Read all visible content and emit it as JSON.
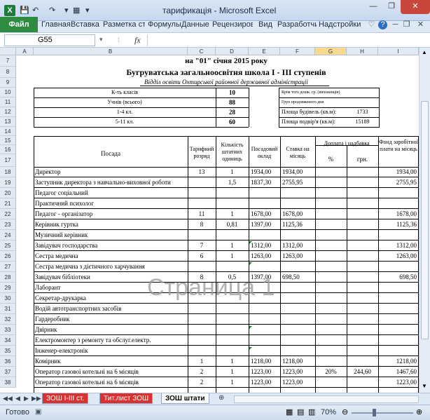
{
  "window": {
    "title": "тарификація  -  Microsoft Excel"
  },
  "ribbon": {
    "file_tab": "Файл",
    "tabs": [
      "Главная",
      "Вставка",
      "Разметка стр",
      "Формулы",
      "Данные",
      "Рецензиров",
      "Вид",
      "Разработчи",
      "Надстройки"
    ]
  },
  "formula_bar": {
    "name_box": "G55",
    "fx": "fx",
    "content": ""
  },
  "columns": [
    "A",
    "B",
    "C",
    "D",
    "E",
    "F",
    "G",
    "H",
    "I"
  ],
  "rows": [
    "7",
    "8",
    "9",
    "10",
    "11",
    "12",
    "13",
    "14",
    "15",
    "16",
    "17",
    "18",
    "19",
    "20",
    "21",
    "22",
    "23",
    "24",
    "25",
    "26",
    "27",
    "28",
    "29",
    "30",
    "31",
    "32",
    "33",
    "34",
    "35",
    "36",
    "37",
    "38"
  ],
  "sheet": {
    "date": "на  \"01\" січня 2015 року",
    "school": "Бугруватська загальноосвітня  школа  І - ІІІ  ступенів",
    "dept": "Відділ  освіти  Охтирської  районної державної  адміністрації",
    "info_left": [
      {
        "label": "К-ть класів",
        "value": "10"
      },
      {
        "label": "Учнів (всього)",
        "value": "88"
      },
      {
        "label": "1-4 кл.",
        "value": "28"
      },
      {
        "label": "5-11 кл.",
        "value": "60"
      }
    ],
    "info_right": [
      {
        "label": "Крім того дошк. гр. (вихованців)",
        "value": ""
      },
      {
        "label": "Груп продовженого  дня",
        "value": ""
      },
      {
        "label": "Площа  будівель (кв.м):",
        "value": "1733"
      },
      {
        "label": "Площа подвір'я (кв.м):",
        "value": "15189"
      }
    ],
    "headers": {
      "position": "Посада",
      "tarif": "Тарифний розряд",
      "count": "Кількість штатних одиниць",
      "salary": "Посадовий оклад",
      "rate": "Ставка на місяць",
      "allowance": "Доплата і надбавка",
      "pct": "%",
      "uah": "грн.",
      "fund": "Фонд заробітної плати на місяць"
    },
    "staff": [
      {
        "name": "Директор",
        "tarif": "13",
        "count": "1",
        "salary": "1934,00",
        "rate": "1934,00",
        "pct": "",
        "uah": "",
        "fund": "1934,00"
      },
      {
        "name": "Заступник директора з навчально-виховної роботи",
        "tarif": "",
        "count": "1,5",
        "salary": "1837,30",
        "rate": "2755,95",
        "pct": "",
        "uah": "",
        "fund": "2755,95"
      },
      {
        "name": "Педагог соціальний",
        "tarif": "",
        "count": "",
        "salary": "",
        "rate": "",
        "pct": "",
        "uah": "",
        "fund": ""
      },
      {
        "name": "Практичний  психолог",
        "tarif": "",
        "count": "",
        "salary": "",
        "rate": "",
        "pct": "",
        "uah": "",
        "fund": ""
      },
      {
        "name": "Педагог - організатор",
        "tarif": "11",
        "count": "1",
        "salary": "1678,00",
        "rate": "1678,00",
        "pct": "",
        "uah": "",
        "fund": "1678,00"
      },
      {
        "name": "Керівник  гуртка",
        "tarif": "8",
        "count": "0,81",
        "salary": "1397,00",
        "rate": "1125,36",
        "pct": "",
        "uah": "",
        "fund": "1125,36"
      },
      {
        "name": "Музичний керівник",
        "tarif": "",
        "count": "",
        "salary": "",
        "rate": "",
        "pct": "",
        "uah": "",
        "fund": ""
      },
      {
        "name": "Завідувач  господарства",
        "tarif": "7",
        "count": "1",
        "salary": "1312,00",
        "rate": "1312,00",
        "pct": "",
        "uah": "",
        "fund": "1312,00"
      },
      {
        "name": "Сестра медична",
        "tarif": "6",
        "count": "1",
        "salary": "1263,00",
        "rate": "1263,00",
        "pct": "",
        "uah": "",
        "fund": "1263,00"
      },
      {
        "name": "Сестра медична з дієтичного харчування",
        "tarif": "",
        "count": "",
        "salary": "",
        "rate": "",
        "pct": "",
        "uah": "",
        "fund": ""
      },
      {
        "name": "Завідувач бібліотеки",
        "tarif": "8",
        "count": "0,5",
        "salary": "1397,00",
        "rate": "698,50",
        "pct": "",
        "uah": "",
        "fund": "698,50"
      },
      {
        "name": "Лаборант",
        "tarif": "",
        "count": "",
        "salary": "",
        "rate": "",
        "pct": "",
        "uah": "",
        "fund": ""
      },
      {
        "name": "Секретар-друкарка",
        "tarif": "",
        "count": "",
        "salary": "",
        "rate": "",
        "pct": "",
        "uah": "",
        "fund": ""
      },
      {
        "name": "Водій автотранспортних засобів",
        "tarif": "",
        "count": "",
        "salary": "",
        "rate": "",
        "pct": "",
        "uah": "",
        "fund": ""
      },
      {
        "name": "Гардеробник",
        "tarif": "",
        "count": "",
        "salary": "",
        "rate": "",
        "pct": "",
        "uah": "",
        "fund": ""
      },
      {
        "name": "Двірник",
        "tarif": "",
        "count": "",
        "salary": "",
        "rate": "",
        "pct": "",
        "uah": "",
        "fund": ""
      },
      {
        "name": "Електромонтер з ремонту та обслуг.електр.",
        "tarif": "",
        "count": "",
        "salary": "",
        "rate": "",
        "pct": "",
        "uah": "",
        "fund": ""
      },
      {
        "name": "Інженер-електронік",
        "tarif": "",
        "count": "",
        "salary": "",
        "rate": "",
        "pct": "",
        "uah": "",
        "fund": ""
      },
      {
        "name": "Комірник",
        "tarif": "1",
        "count": "1",
        "salary": "1218,00",
        "rate": "1218,00",
        "pct": "",
        "uah": "",
        "fund": "1218,00"
      },
      {
        "name": "Оператор газової котельні на 6 місяців",
        "tarif": "2",
        "count": "1",
        "salary": "1223,00",
        "rate": "1223,00",
        "pct": "20%",
        "uah": "244,60",
        "fund": "1467,60"
      },
      {
        "name": "Оператор газової котельні на 6 місяців",
        "tarif": "2",
        "count": "1",
        "salary": "1223,00",
        "rate": "1223,00",
        "pct": "",
        "uah": "",
        "fund": "1223,00"
      }
    ]
  },
  "watermark": "Страница 1",
  "sheet_tabs": [
    "ЗОШ І-ІІІ ст.",
    "Тит.лист ЗОШ",
    "ЗОШ штати"
  ],
  "status": {
    "ready": "Готово",
    "zoom": "70%"
  },
  "accent": "#2e8b3f"
}
